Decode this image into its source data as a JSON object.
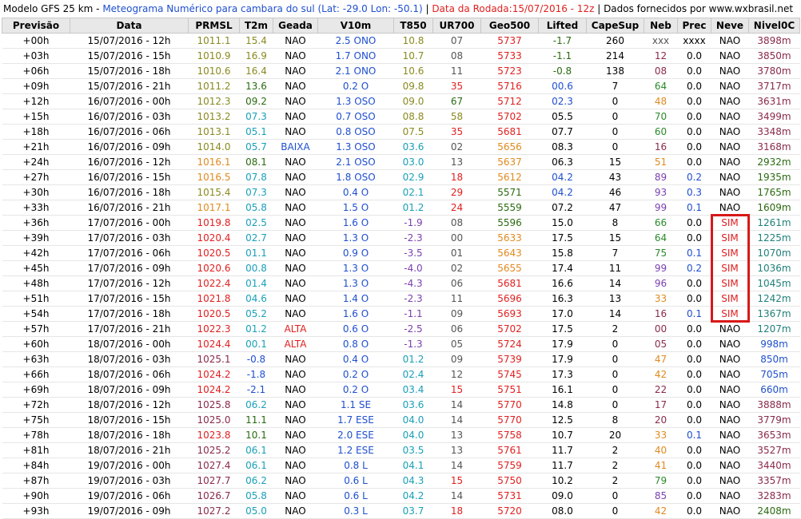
{
  "title": {
    "model": "Modelo GFS 25 km",
    "dash": " - ",
    "desc": "Meteograma Numérico para cambara do sul (Lat: -29.0 Lon: -50.1)",
    "sep1": " | ",
    "run": "Data da Rodada:15/07/2016 - 12z",
    "sep2": " | ",
    "source": "Dados fornecidos por www.wxbrasil.net"
  },
  "columns": [
    "Previsão",
    "Data",
    "PRMSL",
    "T2m",
    "Geada",
    "V10m",
    "T850",
    "UR700",
    "Geo500",
    "Lifted",
    "CapeSup",
    "Neb",
    "Prec",
    "Neve",
    "Nivel0C"
  ],
  "rows": [
    [
      "+00h",
      "15/07/2016 - 12h",
      "1011.1",
      "15.4",
      "NAO",
      "2.5 ONO",
      "10.8",
      "07",
      "5737",
      "-1.7",
      "260",
      "xxx",
      "xxxx",
      "NAO",
      "3898m"
    ],
    [
      "+03h",
      "15/07/2016 - 15h",
      "1010.9",
      "16.9",
      "NAO",
      "1.7 ONO",
      "10.7",
      "08",
      "5733",
      "-1.1",
      "214",
      "12",
      "0.0",
      "NAO",
      "3850m"
    ],
    [
      "+06h",
      "15/07/2016 - 18h",
      "1010.6",
      "16.4",
      "NAO",
      "2.1 ONO",
      "10.6",
      "11",
      "5723",
      "-0.8",
      "138",
      "08",
      "0.0",
      "NAO",
      "3780m"
    ],
    [
      "+09h",
      "15/07/2016 - 21h",
      "1011.2",
      "13.6",
      "NAO",
      "0.2 O",
      "09.8",
      "35",
      "5716",
      "00.6",
      "7",
      "64",
      "0.0",
      "NAO",
      "3717m"
    ],
    [
      "+12h",
      "16/07/2016 - 00h",
      "1012.3",
      "09.2",
      "NAO",
      "1.3 OSO",
      "09.0",
      "67",
      "5712",
      "02.3",
      "0",
      "48",
      "0.0",
      "NAO",
      "3631m"
    ],
    [
      "+15h",
      "16/07/2016 - 03h",
      "1013.2",
      "07.3",
      "NAO",
      "0.7 OSO",
      "08.8",
      "58",
      "5702",
      "05.5",
      "0",
      "70",
      "0.0",
      "NAO",
      "3499m"
    ],
    [
      "+18h",
      "16/07/2016 - 06h",
      "1013.1",
      "05.1",
      "NAO",
      "0.8 OSO",
      "07.5",
      "35",
      "5681",
      "07.7",
      "0",
      "60",
      "0.0",
      "NAO",
      "3348m"
    ],
    [
      "+21h",
      "16/07/2016 - 09h",
      "1014.0",
      "05.7",
      "BAIXA",
      "1.3 OSO",
      "03.6",
      "02",
      "5656",
      "08.3",
      "0",
      "16",
      "0.0",
      "NAO",
      "3168m"
    ],
    [
      "+24h",
      "16/07/2016 - 12h",
      "1016.1",
      "08.1",
      "NAO",
      "2.1 OSO",
      "03.0",
      "13",
      "5637",
      "06.3",
      "15",
      "51",
      "0.0",
      "NAO",
      "2932m"
    ],
    [
      "+27h",
      "16/07/2016 - 15h",
      "1016.5",
      "07.8",
      "NAO",
      "1.8 OSO",
      "02.9",
      "18",
      "5612",
      "04.2",
      "43",
      "89",
      "0.2",
      "NAO",
      "1935m"
    ],
    [
      "+30h",
      "16/07/2016 - 18h",
      "1015.4",
      "07.3",
      "NAO",
      "0.4 O",
      "02.1",
      "29",
      "5571",
      "04.2",
      "46",
      "93",
      "0.3",
      "NAO",
      "1765m"
    ],
    [
      "+33h",
      "16/07/2016 - 21h",
      "1017.1",
      "05.8",
      "NAO",
      "1.5 O",
      "01.2",
      "24",
      "5559",
      "07.2",
      "47",
      "99",
      "0.1",
      "NAO",
      "1609m"
    ],
    [
      "+36h",
      "17/07/2016 - 00h",
      "1019.8",
      "02.5",
      "NAO",
      "1.6 O",
      "-1.9",
      "08",
      "5596",
      "15.0",
      "8",
      "66",
      "0.0",
      "SIM",
      "1261m"
    ],
    [
      "+39h",
      "17/07/2016 - 03h",
      "1020.4",
      "02.7",
      "NAO",
      "1.3 O",
      "-2.3",
      "00",
      "5633",
      "17.5",
      "15",
      "64",
      "0.0",
      "SIM",
      "1225m"
    ],
    [
      "+42h",
      "17/07/2016 - 06h",
      "1020.5",
      "01.1",
      "NAO",
      "0.9 O",
      "-3.5",
      "01",
      "5643",
      "15.8",
      "7",
      "75",
      "0.1",
      "SIM",
      "1070m"
    ],
    [
      "+45h",
      "17/07/2016 - 09h",
      "1020.6",
      "00.8",
      "NAO",
      "1.3 O",
      "-4.0",
      "02",
      "5655",
      "17.4",
      "11",
      "99",
      "0.2",
      "SIM",
      "1036m"
    ],
    [
      "+48h",
      "17/07/2016 - 12h",
      "1022.4",
      "01.4",
      "NAO",
      "1.3 O",
      "-4.3",
      "06",
      "5681",
      "16.6",
      "14",
      "96",
      "0.0",
      "SIM",
      "1045m"
    ],
    [
      "+51h",
      "17/07/2016 - 15h",
      "1021.8",
      "04.6",
      "NAO",
      "1.4 O",
      "-2.3",
      "11",
      "5696",
      "16.3",
      "13",
      "33",
      "0.0",
      "SIM",
      "1242m"
    ],
    [
      "+54h",
      "17/07/2016 - 18h",
      "1020.5",
      "05.2",
      "NAO",
      "1.6 O",
      "-1.1",
      "09",
      "5693",
      "17.0",
      "14",
      "16",
      "0.1",
      "SIM",
      "1367m"
    ],
    [
      "+57h",
      "17/07/2016 - 21h",
      "1022.3",
      "01.2",
      "ALTA",
      "0.6 O",
      "-2.5",
      "06",
      "5702",
      "17.5",
      "2",
      "00",
      "0.0",
      "NAO",
      "1207m"
    ],
    [
      "+60h",
      "18/07/2016 - 00h",
      "1024.4",
      "00.1",
      "ALTA",
      "0.8 O",
      "-1.3",
      "05",
      "5724",
      "17.9",
      "0",
      "05",
      "0.0",
      "NAO",
      "998m"
    ],
    [
      "+63h",
      "18/07/2016 - 03h",
      "1025.1",
      "-0.8",
      "NAO",
      "0.4 O",
      "01.2",
      "09",
      "5739",
      "17.9",
      "0",
      "47",
      "0.0",
      "NAO",
      "850m"
    ],
    [
      "+66h",
      "18/07/2016 - 06h",
      "1024.2",
      "-1.8",
      "NAO",
      "0.2 O",
      "02.4",
      "12",
      "5745",
      "17.3",
      "0",
      "42",
      "0.0",
      "NAO",
      "705m"
    ],
    [
      "+69h",
      "18/07/2016 - 09h",
      "1024.2",
      "-2.1",
      "NAO",
      "0.2 O",
      "03.4",
      "15",
      "5751",
      "16.1",
      "0",
      "22",
      "0.0",
      "NAO",
      "660m"
    ],
    [
      "+72h",
      "18/07/2016 - 12h",
      "1025.8",
      "06.2",
      "NAO",
      "1.1 SE",
      "03.6",
      "14",
      "5770",
      "14.8",
      "0",
      "17",
      "0.0",
      "NAO",
      "3888m"
    ],
    [
      "+75h",
      "18/07/2016 - 15h",
      "1025.0",
      "11.1",
      "NAO",
      "1.7 ESE",
      "04.0",
      "14",
      "5770",
      "12.5",
      "8",
      "20",
      "0.0",
      "NAO",
      "3779m"
    ],
    [
      "+78h",
      "18/07/2016 - 18h",
      "1023.8",
      "10.1",
      "NAO",
      "2.0 ESE",
      "04.0",
      "13",
      "5758",
      "10.7",
      "20",
      "33",
      "0.1",
      "NAO",
      "3653m"
    ],
    [
      "+81h",
      "18/07/2016 - 21h",
      "1025.2",
      "06.1",
      "NAO",
      "1.2 ESE",
      "03.5",
      "13",
      "5761",
      "11.7",
      "2",
      "40",
      "0.0",
      "NAO",
      "3527m"
    ],
    [
      "+84h",
      "19/07/2016 - 00h",
      "1027.4",
      "06.1",
      "NAO",
      "0.8 L",
      "04.1",
      "14",
      "5759",
      "11.7",
      "2",
      "41",
      "0.0",
      "NAO",
      "3440m"
    ],
    [
      "+87h",
      "19/07/2016 - 03h",
      "1027.7",
      "06.2",
      "NAO",
      "0.6 L",
      "04.3",
      "15",
      "5750",
      "10.2",
      "2",
      "79",
      "0.0",
      "NAO",
      "3357m"
    ],
    [
      "+90h",
      "19/07/2016 - 06h",
      "1026.7",
      "05.8",
      "NAO",
      "0.6 L",
      "04.2",
      "14",
      "5731",
      "09.0",
      "0",
      "85",
      "0.0",
      "NAO",
      "3283m"
    ],
    [
      "+93h",
      "19/07/2016 - 09h",
      "1027.2",
      "05.0",
      "NAO",
      "0.3 L",
      "03.7",
      "18",
      "5720",
      "08.0",
      "0",
      "42",
      "0.0",
      "NAO",
      "2408m"
    ]
  ],
  "colors": {
    "default": "#000000",
    "red": "#e02020",
    "blue": "#1f4fd0",
    "cyan": "#1aa0b8",
    "olive": "#8a8a20",
    "green": "#2a8a2a",
    "darkgreen": "#2a6a10",
    "orange": "#e08a20",
    "purple": "#7a3fb0",
    "maroon": "#8a2a4a",
    "teal": "#20807a",
    "gray": "#555555"
  },
  "highlight": {
    "column": "Neve",
    "value": "SIM"
  }
}
